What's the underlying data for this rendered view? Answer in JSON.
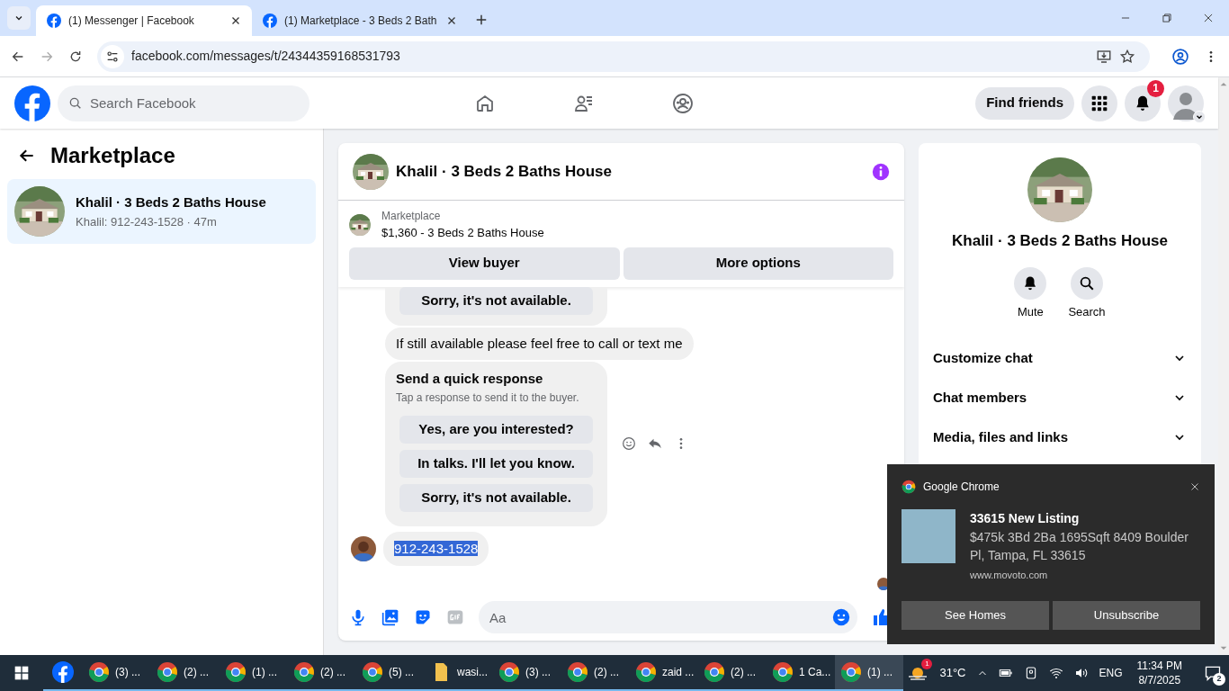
{
  "browser": {
    "tabs": [
      {
        "title": "(1) Messenger | Facebook",
        "selected": true
      },
      {
        "title": "(1) Marketplace - 3 Beds 2 Bath",
        "selected": false
      }
    ],
    "url": "facebook.com/messages/t/24344359168531793"
  },
  "header": {
    "search_placeholder": "Search Facebook",
    "find_friends": "Find friends",
    "notification_count": "1"
  },
  "sidebar": {
    "title": "Marketplace",
    "chats": [
      {
        "name": "Khalil · 3 Beds 2 Baths House",
        "preview": "Khalil: 912-243-1528 · 47m",
        "selected": true
      }
    ]
  },
  "chat": {
    "title": "Khalil · 3 Beds 2 Baths House",
    "listing": {
      "source": "Marketplace",
      "title": "$1,360 - 3 Beds 2 Baths House"
    },
    "actions": [
      "View buyer",
      "More options"
    ],
    "messages": [
      {
        "kind": "option_tail",
        "options": [
          "Sorry, it's not available."
        ]
      },
      {
        "kind": "text",
        "text": "If still available please feel free to call or text me"
      },
      {
        "kind": "quick",
        "title": "Send a quick response",
        "subtitle": "Tap a response to send it to the buyer.",
        "options": [
          "Yes, are you interested?",
          "In talks. I'll let you know.",
          "Sorry, it's not available."
        ]
      },
      {
        "kind": "phone",
        "text": "912-243-1528",
        "selected": true
      }
    ],
    "composer_placeholder": "Aa"
  },
  "details": {
    "name": "Khalil · 3 Beds 2 Baths House",
    "actions": [
      {
        "kind": "mute",
        "label": "Mute"
      },
      {
        "kind": "search",
        "label": "Search"
      }
    ],
    "sections": [
      "Customize chat",
      "Chat members",
      "Media, files and links"
    ]
  },
  "notification": {
    "app": "Google Chrome",
    "title": "33615 New Listing",
    "body": "$475k 3Bd 2Ba 1695Sqft 8409 Boulder Pl, Tampa, FL 33615",
    "site": "www.movoto.com",
    "buttons": [
      "See Homes",
      "Unsubscribe"
    ]
  },
  "taskbar": {
    "items": [
      {
        "kind": "facebook",
        "selected": false
      },
      {
        "kind": "chrome",
        "label": "(3) ...",
        "selected": false
      },
      {
        "kind": "chrome",
        "label": "(2) ...",
        "selected": false
      },
      {
        "kind": "chrome",
        "label": "(1) ...",
        "selected": false
      },
      {
        "kind": "chrome",
        "label": "(2) ...",
        "selected": false
      },
      {
        "kind": "chrome",
        "label": "(5) ...",
        "selected": false
      },
      {
        "kind": "folder",
        "label": "wasi...",
        "selected": false
      },
      {
        "kind": "chrome",
        "label": "(3) ...",
        "selected": false
      },
      {
        "kind": "chrome",
        "label": "(2) ...",
        "selected": false
      },
      {
        "kind": "chrome",
        "label": "zaid ...",
        "selected": false
      },
      {
        "kind": "chrome",
        "label": "(2) ...",
        "selected": false
      },
      {
        "kind": "chrome",
        "label": "1 Ca...",
        "selected": false
      },
      {
        "kind": "chrome",
        "label": "(1) ...",
        "selected": true
      }
    ],
    "weather_badge": "1",
    "temperature": "31°C",
    "language": "ENG",
    "time": "11:34 PM",
    "date": "8/7/2025",
    "notifications": "2"
  }
}
